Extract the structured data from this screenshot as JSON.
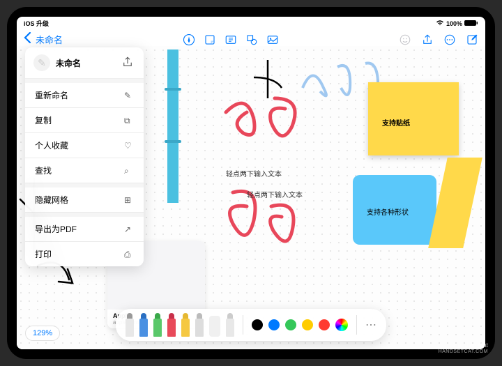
{
  "status": {
    "left": "iOS 升级",
    "battery": "100%"
  },
  "nav": {
    "title": "未命名"
  },
  "menu": {
    "title": "未命名",
    "items": [
      {
        "label": "重新命名",
        "icon": "pencil"
      },
      {
        "label": "复制",
        "icon": "copy"
      },
      {
        "label": "个人收藏",
        "icon": "heart"
      },
      {
        "label": "查找",
        "icon": "search"
      },
      {
        "label": "隐藏网格",
        "icon": "grid"
      },
      {
        "label": "导出为PDF",
        "icon": "export"
      },
      {
        "label": "打印",
        "icon": "print"
      }
    ]
  },
  "canvas": {
    "text1": "轻点两下输入文本",
    "text2": "轻点两下输入文本",
    "sticky": "支持贴纸",
    "shape": "支持各种形状"
  },
  "apple_card": {
    "title": "Apple",
    "subtitle": "apple.com"
  },
  "zoom": "129%",
  "colors": [
    "#000000",
    "#007aff",
    "#34c759",
    "#ffcc00",
    "#ff3b30"
  ],
  "watermark": {
    "line1": "Handset Cat",
    "line2": "HANDSETCAT.COM"
  }
}
